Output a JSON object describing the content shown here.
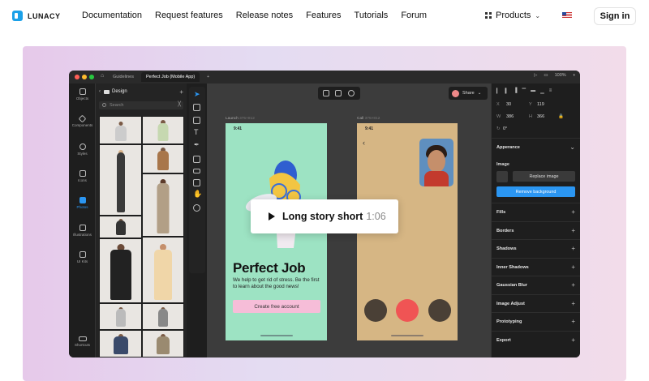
{
  "nav": {
    "logo": "LUNACY",
    "links": [
      "Documentation",
      "Request features",
      "Release notes",
      "Features",
      "Tutorials",
      "Forum"
    ],
    "products": "Products",
    "signin": "Sign in"
  },
  "app": {
    "tabs": [
      "Guidelines",
      "Perfect Job (Mobile App)",
      "+"
    ],
    "zoom": "100%",
    "rail": [
      "Objects",
      "Components",
      "Styles",
      "Icons",
      "Photos",
      "Illustrations",
      "UI Kits",
      "Shortcuts"
    ],
    "panel": {
      "title": "Design",
      "search_placeholder": "Search"
    },
    "canvas": {
      "share": "Share",
      "frame1_label": "Launch",
      "frame1_size": "375×812",
      "frame2_label": "Call",
      "frame2_size": "375×812",
      "time1": "9:41",
      "time2": "9:41",
      "headline": "Perfect Job",
      "subtext": "We help to get rid of stress. Be the first to learn about the good news!",
      "cta": "Create free account"
    },
    "inspector": {
      "x": "30",
      "y": "119",
      "w": "386",
      "h": "366",
      "rotation": "0°",
      "appearance": "Apperance",
      "image": "Image",
      "replace": "Replace image",
      "remove_bg": "Remove background",
      "sections": [
        "Fills",
        "Borders",
        "Shadows",
        "Inner Shadows",
        "Gaussian Blur",
        "Image Adjust",
        "Prototyping",
        "Export"
      ]
    }
  },
  "video": {
    "title": "Long story short",
    "duration": "1:06"
  },
  "colors": {
    "accent": "#2b96f2",
    "frame1": "#9de3c3",
    "frame2": "#d6b684",
    "cta": "#f6bdd8",
    "call_red": "#f05454"
  }
}
